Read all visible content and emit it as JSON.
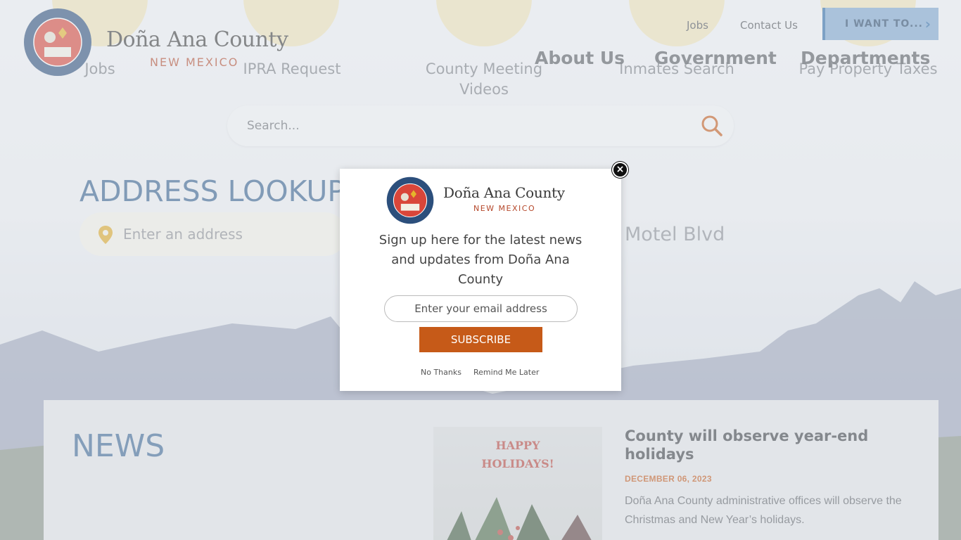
{
  "header": {
    "brand_name": "Doña Ana County",
    "brand_sub": "NEW MEXICO",
    "top_links": [
      "Jobs",
      "Contact Us"
    ],
    "cta_label": "I WANT TO..."
  },
  "main_nav": [
    "About Us",
    "Government",
    "Departments"
  ],
  "quick_links": [
    "Jobs",
    "IPRA Request",
    "County Meeting Videos",
    "Inmates Search",
    "Pay Property Taxes"
  ],
  "search": {
    "placeholder": "Search..."
  },
  "address_lookup": {
    "title": "ADDRESS LOOKUP",
    "placeholder": "Enter an address",
    "example": "Motel Blvd"
  },
  "news": {
    "title": "NEWS",
    "image_caption": [
      "HAPPY",
      "HOLIDAYS!"
    ],
    "headline": "County will observe year-end holidays",
    "date": "DECEMBER 06, 2023",
    "summary": "Doña Ana County administrative offices will observe the Christmas and New Year’s holidays."
  },
  "popup": {
    "close_symbol": "×",
    "brand_name": "Doña Ana County",
    "brand_sub": "NEW MEXICO",
    "message": "Sign up here for the latest news and updates from Doña Ana County",
    "email_placeholder": "Enter your email address",
    "subscribe_label": "SUBSCRIBE",
    "no_thanks_label": "No Thanks",
    "remind_label": "Remind Me Later"
  },
  "colors": {
    "accent_blue": "#345f8e",
    "accent_orange": "#c65a18",
    "brand_red": "#b5472a",
    "cta_blue": "#7ea6cf"
  }
}
